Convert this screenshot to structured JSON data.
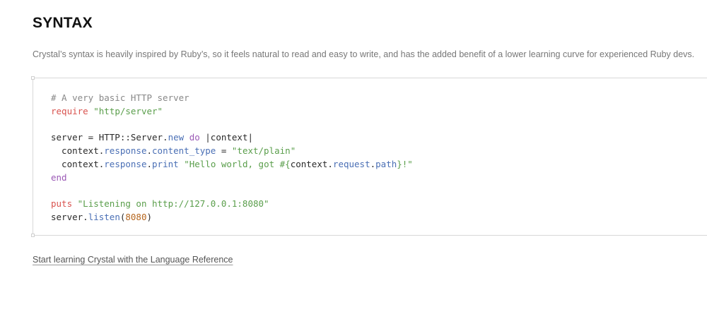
{
  "section": {
    "title": "SYNTAX",
    "intro": "Crystal’s syntax is heavily inspired by Ruby’s, so it feels natural to read and easy to write, and has the added benefit of a lower learning curve for experienced Ruby devs."
  },
  "code": {
    "line1": {
      "comment": "# A very basic HTTP server"
    },
    "line2": {
      "kw": "require",
      "sp": " ",
      "str": "\"http/server\""
    },
    "line4": {
      "a": "server = HTTP::Server.",
      "m": "new",
      "sp": " ",
      "do": "do",
      "b": " |context|"
    },
    "line5": {
      "a": "  context.",
      "m1": "response",
      "dot": ".",
      "m2": "content_type",
      "b": " = ",
      "str": "\"text/plain\""
    },
    "line6": {
      "a": "  context.",
      "m1": "response",
      "dot": ".",
      "m2": "print",
      "sp": " ",
      "str1": "\"Hello world, got #{",
      "b": "context.",
      "m3": "request",
      "dot2": ".",
      "m4": "path",
      "str2": "}!\""
    },
    "line7": {
      "end": "end"
    },
    "line9": {
      "kw": "puts",
      "sp": " ",
      "str": "\"Listening on http://127.0.0.1:8080\""
    },
    "line10": {
      "a": "server.",
      "m": "listen",
      "p1": "(",
      "num": "8080",
      "p2": ")"
    }
  },
  "link": {
    "label": "Start learning Crystal with the Language Reference"
  }
}
